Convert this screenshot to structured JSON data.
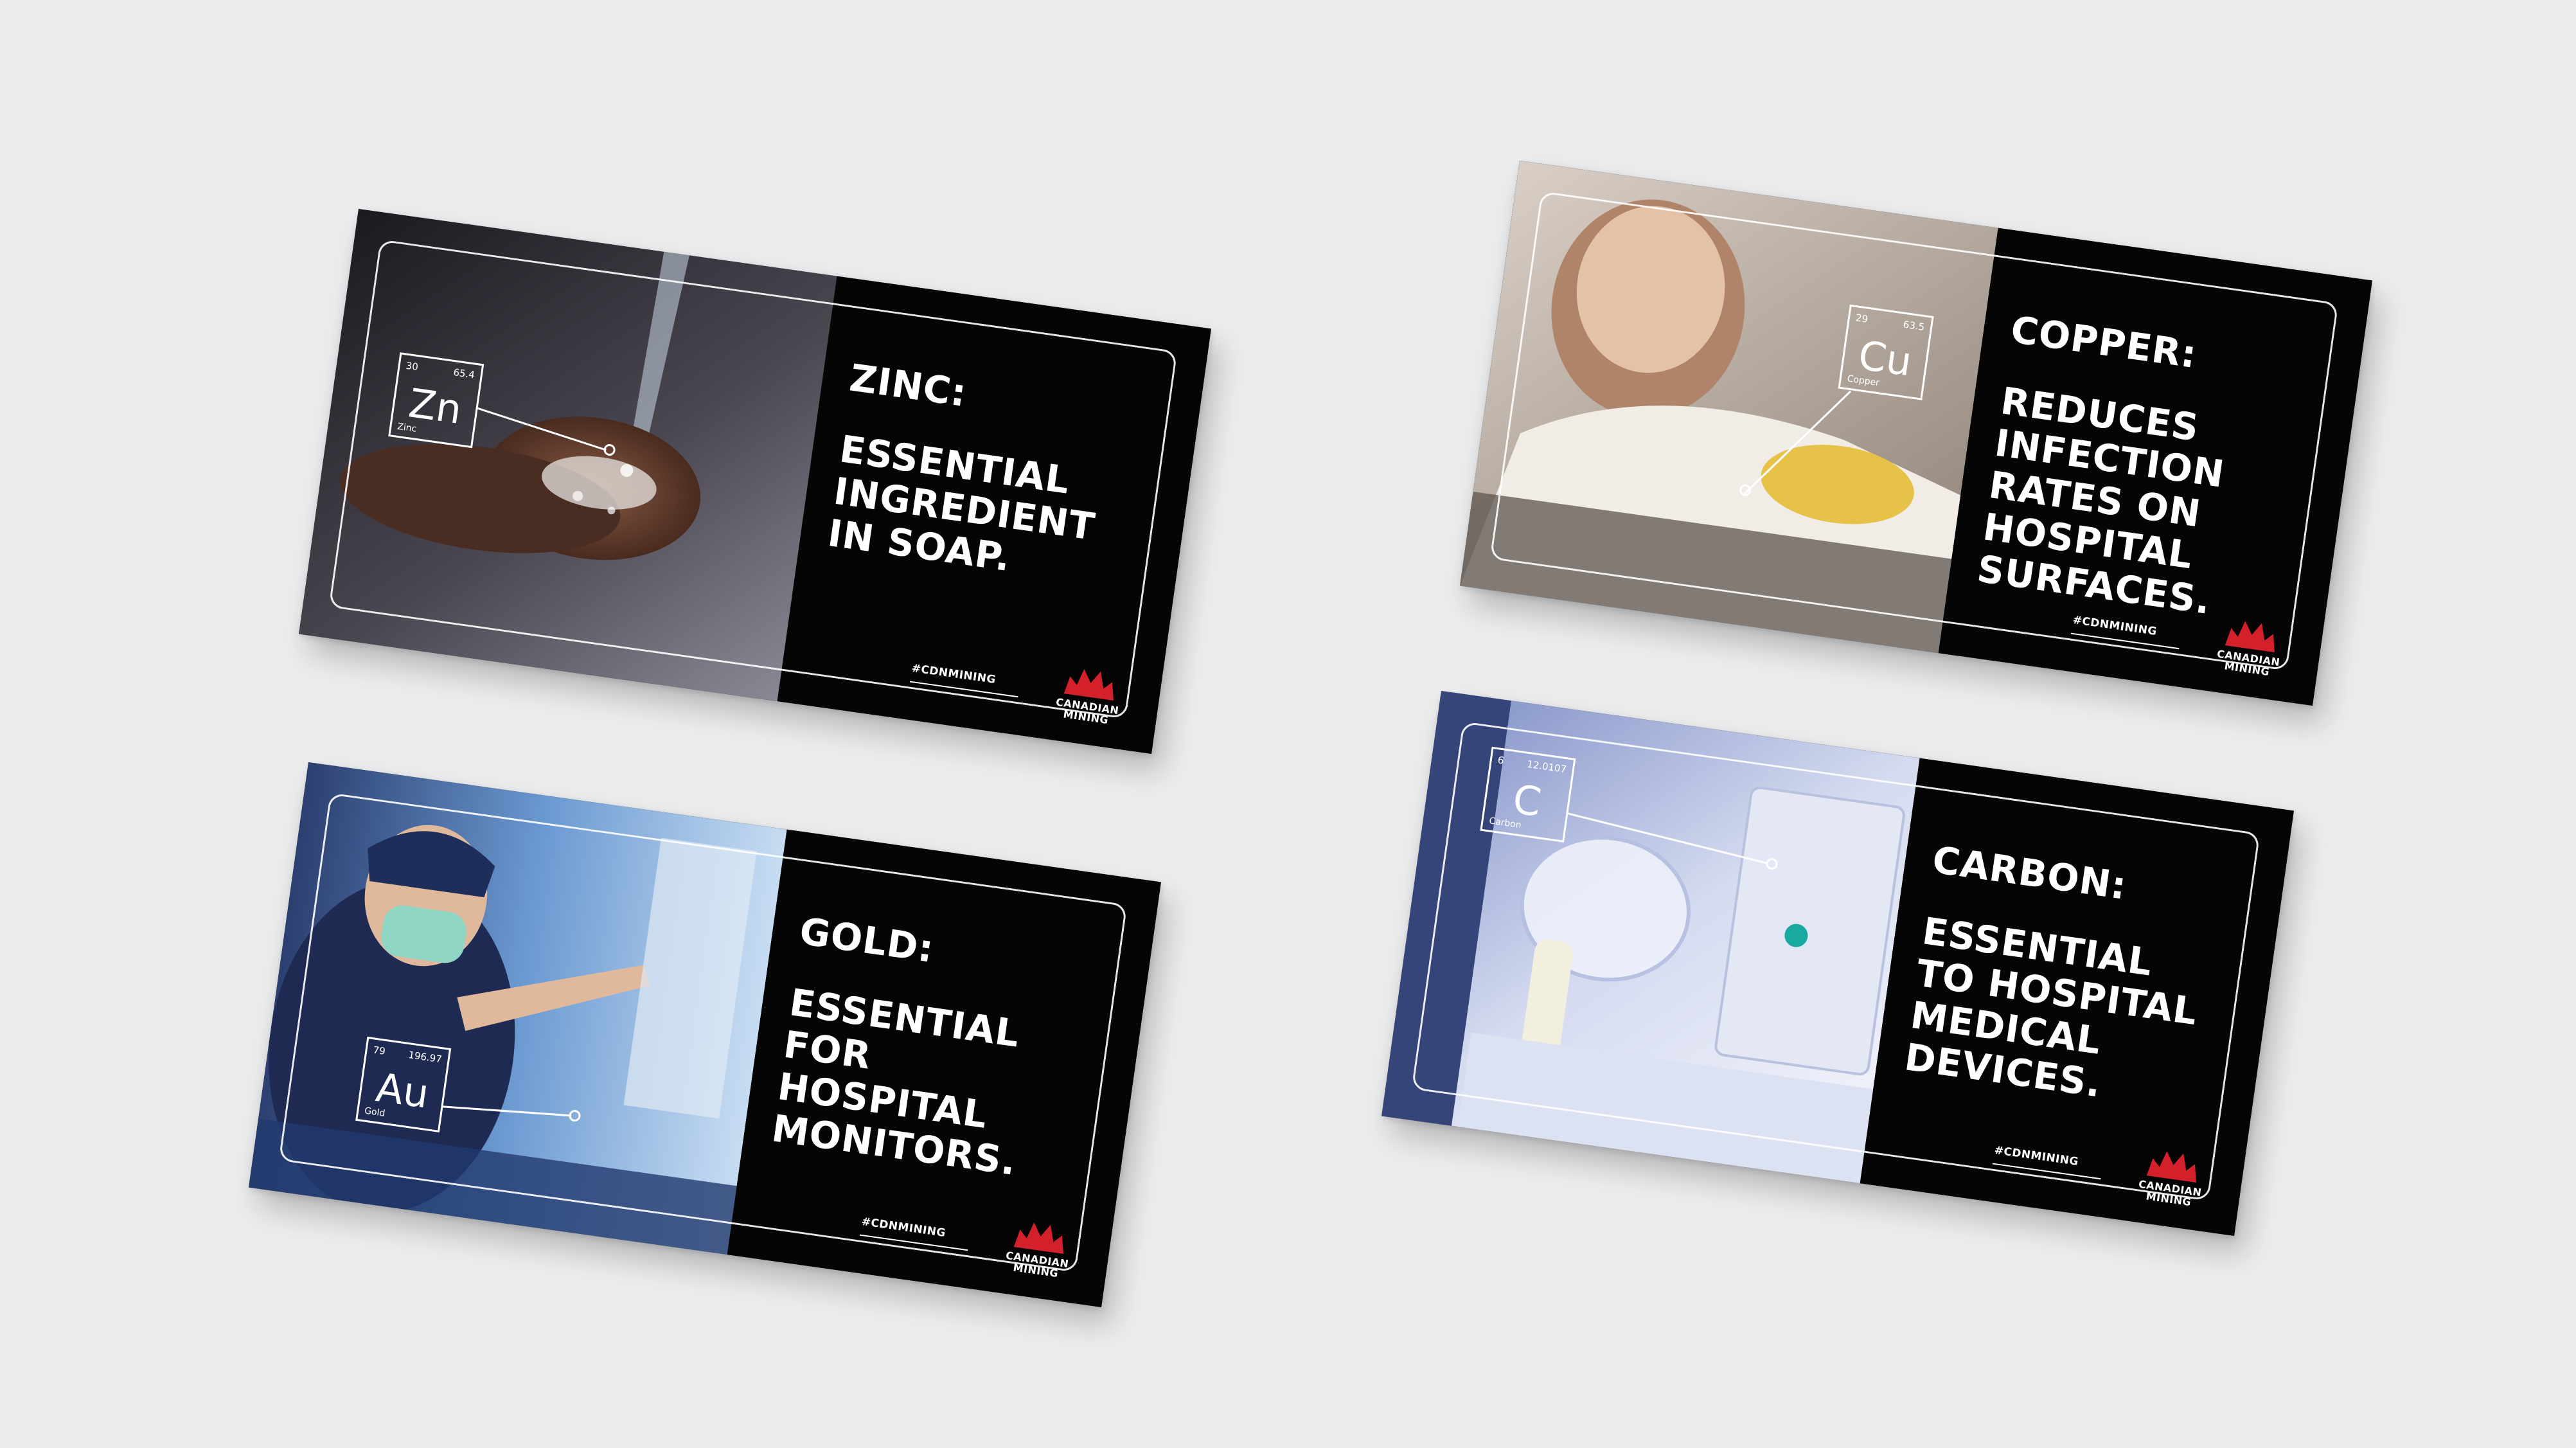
{
  "cards": [
    {
      "id": "zinc",
      "element": {
        "symbol": "Zn",
        "number": "30",
        "mass": "65.4",
        "name": "Zinc"
      },
      "headline": {
        "element_line": "ZINC:",
        "body": "ESSENTIAL INGREDIENT IN SOAP."
      },
      "hashtag": "#CDNMINING",
      "logo": {
        "line1": "CANADIAN",
        "line2": "MINING"
      },
      "photo_subject": "hands-washing-with-soap",
      "palette": [
        "#2f2a2c",
        "#6b4a3a",
        "#a77a62",
        "#d9c9c2"
      ]
    },
    {
      "id": "copper",
      "element": {
        "symbol": "Cu",
        "number": "29",
        "mass": "63.5",
        "name": "Copper"
      },
      "headline": {
        "element_line": "COPPER:",
        "body": "REDUCES INFECTION RATES ON HOSPITAL SURFACES."
      },
      "hashtag": "#CDNMINING",
      "logo": {
        "line1": "CANADIAN",
        "line2": "MINING"
      },
      "photo_subject": "woman-cleaning-surface",
      "palette": [
        "#8a7a6e",
        "#cdbfb2",
        "#e9dfd4",
        "#e0c35a"
      ]
    },
    {
      "id": "gold",
      "element": {
        "symbol": "Au",
        "number": "79",
        "mass": "196.97",
        "name": "Gold"
      },
      "headline": {
        "element_line": "GOLD:",
        "body": "ESSENTIAL FOR HOSPITAL MONITORS."
      },
      "hashtag": "#CDNMINING",
      "logo": {
        "line1": "CANADIAN",
        "line2": "MINING"
      },
      "photo_subject": "surgeon-at-monitor",
      "palette": [
        "#1c2b52",
        "#3f6fb0",
        "#9cc0e6",
        "#7dd6c6"
      ]
    },
    {
      "id": "carbon",
      "element": {
        "symbol": "C",
        "number": "6",
        "mass": "12.0107",
        "name": "Carbon"
      },
      "headline": {
        "element_line": "CARBON:",
        "body": "ESSENTIAL TO HOSPITAL MEDICAL DEVICES."
      },
      "hashtag": "#CDNMINING",
      "logo": {
        "line1": "CANADIAN",
        "line2": "MINING"
      },
      "photo_subject": "anesthesia-mask-device",
      "palette": [
        "#3a4a7a",
        "#9aa8d8",
        "#dfe4f5",
        "#f4f6fb"
      ]
    }
  ],
  "colors": {
    "background": "#ebecee",
    "panel": "#050505",
    "logo_red": "#d4202a"
  }
}
